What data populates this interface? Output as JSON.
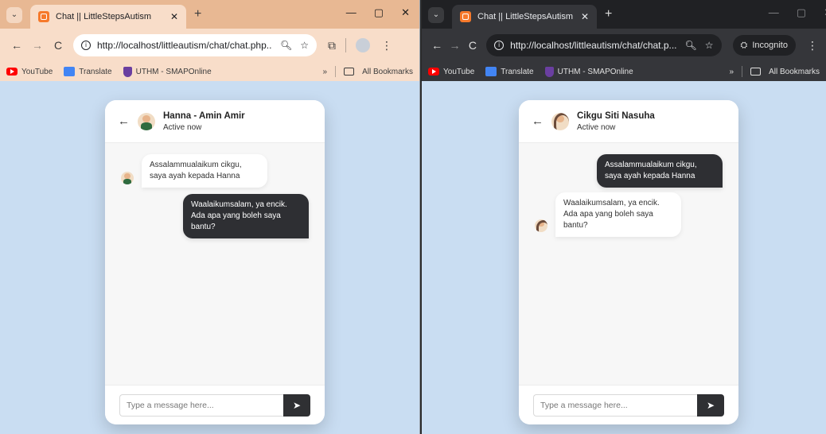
{
  "left": {
    "tab_search_icon": "⌄",
    "tab_title": "Chat || LittleStepsAutism",
    "tab_close": "✕",
    "new_tab": "+",
    "win_min": "—",
    "win_max": "▢",
    "win_close": "✕",
    "nav_back": "←",
    "nav_forward": "→",
    "nav_reload": "C",
    "url": "http://localhost/littleautism/chat/chat.php...",
    "bookmarks": {
      "youtube": "YouTube",
      "translate": "Translate",
      "uthm": "UTHM - SMAPOnline",
      "more": "»",
      "all": "All Bookmarks"
    },
    "chat": {
      "back_icon": "←",
      "name": "Hanna - Amin Amir",
      "status": "Active now",
      "messages": [
        {
          "direction": "incoming",
          "text": "Assalammualaikum cikgu, saya ayah kepada Hanna"
        },
        {
          "direction": "outgoing",
          "text": "Waalaikumsalam, ya encik. Ada apa yang boleh saya bantu?"
        }
      ],
      "input_placeholder": "Type a message here...",
      "send_icon": "➤"
    }
  },
  "right": {
    "tab_search_icon": "⌄",
    "tab_title": "Chat || LittleStepsAutism",
    "tab_close": "✕",
    "new_tab": "+",
    "win_min": "—",
    "win_max": "▢",
    "win_close": "✕",
    "nav_back": "←",
    "nav_forward": "→",
    "nav_reload": "C",
    "url": "http://localhost/littleautism/chat/chat.p...",
    "incognito_label": "Incognito",
    "bookmarks": {
      "youtube": "YouTube",
      "translate": "Translate",
      "uthm": "UTHM - SMAPOnline",
      "more": "»",
      "all": "All Bookmarks"
    },
    "chat": {
      "back_icon": "←",
      "name": "Cikgu Siti Nasuha",
      "status": "Active now",
      "messages": [
        {
          "direction": "outgoing",
          "text": "Assalammualaikum cikgu, saya ayah kepada Hanna"
        },
        {
          "direction": "incoming",
          "text": "Waalaikumsalam, ya encik. Ada apa yang boleh saya bantu?"
        }
      ],
      "input_placeholder": "Type a message here...",
      "send_icon": "➤"
    }
  },
  "colors": {
    "light_frame": "#e8b893",
    "light_toolbar": "#f8ddc9",
    "dark_frame": "#202124",
    "dark_toolbar": "#35363a",
    "page_background": "#c9ddf2",
    "outgoing_bubble": "#2e2f33",
    "incoming_bubble": "#ffffff"
  }
}
